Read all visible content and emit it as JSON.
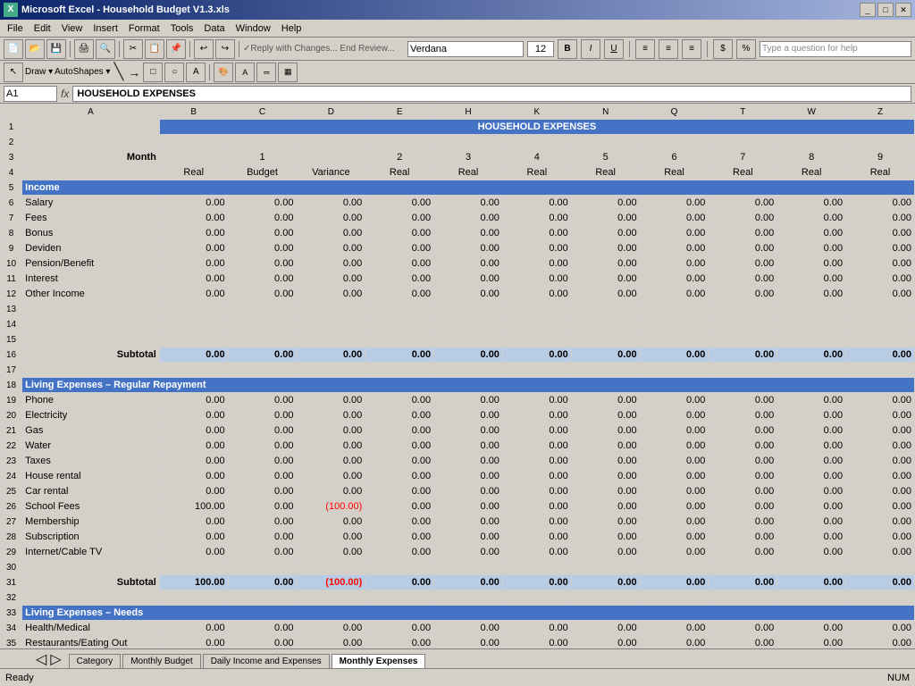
{
  "titleBar": {
    "title": "Microsoft Excel - Household Budget V1.3.xls",
    "icon": "📊"
  },
  "menuBar": {
    "items": [
      "File",
      "Edit",
      "View",
      "Insert",
      "Format",
      "Tools",
      "Data",
      "Window",
      "Help"
    ]
  },
  "toolbar": {
    "font": "Verdana",
    "size": "12",
    "helpPlaceholder": "Type a question for help"
  },
  "formulaBar": {
    "cellRef": "A1",
    "content": "HOUSEHOLD EXPENSES"
  },
  "spreadsheet": {
    "title": "HOUSEHOLD EXPENSES",
    "columnHeaders": [
      "A",
      "B",
      "C",
      "D",
      "E",
      "H",
      "K",
      "N",
      "Q",
      "T",
      "W",
      "Z"
    ],
    "rows": {
      "row3": {
        "label": "Month",
        "months": [
          "1",
          "",
          "",
          "2",
          "3",
          "4",
          "5",
          "6",
          "7",
          "8",
          "9"
        ]
      },
      "row4": {
        "label": "",
        "subheaders": [
          "Real",
          "Budget",
          "Variance",
          "Real",
          "Real",
          "Real",
          "Real",
          "Real",
          "Real",
          "Real",
          "Real"
        ]
      },
      "row5": {
        "label": "Income",
        "isSection": true
      },
      "row6": {
        "label": "Salary",
        "values": [
          "0.00",
          "0.00",
          "0.00",
          "0.00",
          "0.00",
          "0.00",
          "0.00",
          "0.00",
          "0.00",
          "0.00",
          "0.00"
        ]
      },
      "row7": {
        "label": "Fees",
        "values": [
          "0.00",
          "0.00",
          "0.00",
          "0.00",
          "0.00",
          "0.00",
          "0.00",
          "0.00",
          "0.00",
          "0.00",
          "0.00"
        ]
      },
      "row8": {
        "label": "Bonus",
        "values": [
          "0.00",
          "0.00",
          "0.00",
          "0.00",
          "0.00",
          "0.00",
          "0.00",
          "0.00",
          "0.00",
          "0.00",
          "0.00"
        ]
      },
      "row9": {
        "label": "Deviden",
        "values": [
          "0.00",
          "0.00",
          "0.00",
          "0.00",
          "0.00",
          "0.00",
          "0.00",
          "0.00",
          "0.00",
          "0.00",
          "0.00"
        ]
      },
      "row10": {
        "label": "Pension/Benefit",
        "values": [
          "0.00",
          "0.00",
          "0.00",
          "0.00",
          "0.00",
          "0.00",
          "0.00",
          "0.00",
          "0.00",
          "0.00",
          "0.00"
        ]
      },
      "row11": {
        "label": "Interest",
        "values": [
          "0.00",
          "0.00",
          "0.00",
          "0.00",
          "0.00",
          "0.00",
          "0.00",
          "0.00",
          "0.00",
          "0.00",
          "0.00"
        ]
      },
      "row12": {
        "label": "Other Income",
        "values": [
          "0.00",
          "0.00",
          "0.00",
          "0.00",
          "0.00",
          "0.00",
          "0.00",
          "0.00",
          "0.00",
          "0.00",
          "0.00"
        ]
      },
      "row16": {
        "label": "Subtotal",
        "isSubtotal": true,
        "values": [
          "0.00",
          "0.00",
          "0.00",
          "0.00",
          "0.00",
          "0.00",
          "0.00",
          "0.00",
          "0.00",
          "0.00",
          "0.00"
        ]
      },
      "row18": {
        "label": "Living Expenses – Regular Repayment",
        "isSection": true
      },
      "row19": {
        "label": "Phone",
        "values": [
          "0.00",
          "0.00",
          "0.00",
          "0.00",
          "0.00",
          "0.00",
          "0.00",
          "0.00",
          "0.00",
          "0.00",
          "0.00"
        ]
      },
      "row20": {
        "label": "Electricity",
        "values": [
          "0.00",
          "0.00",
          "0.00",
          "0.00",
          "0.00",
          "0.00",
          "0.00",
          "0.00",
          "0.00",
          "0.00",
          "0.00"
        ]
      },
      "row21": {
        "label": "Gas",
        "values": [
          "0.00",
          "0.00",
          "0.00",
          "0.00",
          "0.00",
          "0.00",
          "0.00",
          "0.00",
          "0.00",
          "0.00",
          "0.00"
        ]
      },
      "row22": {
        "label": "Water",
        "values": [
          "0.00",
          "0.00",
          "0.00",
          "0.00",
          "0.00",
          "0.00",
          "0.00",
          "0.00",
          "0.00",
          "0.00",
          "0.00"
        ]
      },
      "row23": {
        "label": "Taxes",
        "values": [
          "0.00",
          "0.00",
          "0.00",
          "0.00",
          "0.00",
          "0.00",
          "0.00",
          "0.00",
          "0.00",
          "0.00",
          "0.00"
        ]
      },
      "row24": {
        "label": "House rental",
        "values": [
          "0.00",
          "0.00",
          "0.00",
          "0.00",
          "0.00",
          "0.00",
          "0.00",
          "0.00",
          "0.00",
          "0.00",
          "0.00"
        ]
      },
      "row25": {
        "label": "Car rental",
        "values": [
          "0.00",
          "0.00",
          "0.00",
          "0.00",
          "0.00",
          "0.00",
          "0.00",
          "0.00",
          "0.00",
          "0.00",
          "0.00"
        ]
      },
      "row26": {
        "label": "School Fees",
        "values": [
          "100.00",
          "0.00",
          "(100.00)",
          "0.00",
          "0.00",
          "0.00",
          "0.00",
          "0.00",
          "0.00",
          "0.00",
          "0.00"
        ],
        "negativeIdx": 2
      },
      "row27": {
        "label": "Membership",
        "values": [
          "0.00",
          "0.00",
          "0.00",
          "0.00",
          "0.00",
          "0.00",
          "0.00",
          "0.00",
          "0.00",
          "0.00",
          "0.00"
        ]
      },
      "row28": {
        "label": "Subscription",
        "values": [
          "0.00",
          "0.00",
          "0.00",
          "0.00",
          "0.00",
          "0.00",
          "0.00",
          "0.00",
          "0.00",
          "0.00",
          "0.00"
        ]
      },
      "row29": {
        "label": "Internet/Cable TV",
        "values": [
          "0.00",
          "0.00",
          "0.00",
          "0.00",
          "0.00",
          "0.00",
          "0.00",
          "0.00",
          "0.00",
          "0.00",
          "0.00"
        ]
      },
      "row31": {
        "label": "Subtotal",
        "isSubtotal": true,
        "values": [
          "100.00",
          "0.00",
          "(100.00)",
          "0.00",
          "0.00",
          "0.00",
          "0.00",
          "0.00",
          "0.00",
          "0.00",
          "0.00"
        ],
        "negativeIdx": 2
      },
      "row33": {
        "label": "Living Expenses – Needs",
        "isSection": true
      },
      "row34": {
        "label": "Health/Medical",
        "values": [
          "0.00",
          "0.00",
          "0.00",
          "0.00",
          "0.00",
          "0.00",
          "0.00",
          "0.00",
          "0.00",
          "0.00",
          "0.00"
        ]
      },
      "row35": {
        "label": "Restaurants/Eating Out",
        "values": [
          "0.00",
          "0.00",
          "0.00",
          "0.00",
          "0.00",
          "0.00",
          "0.00",
          "0.00",
          "0.00",
          "0.00",
          "0.00"
        ]
      }
    },
    "tabs": [
      "Category",
      "Monthly Budget",
      "Daily Income and Expenses",
      "Monthly Expenses"
    ]
  },
  "statusBar": {
    "ready": "Ready",
    "num": "NUM"
  }
}
